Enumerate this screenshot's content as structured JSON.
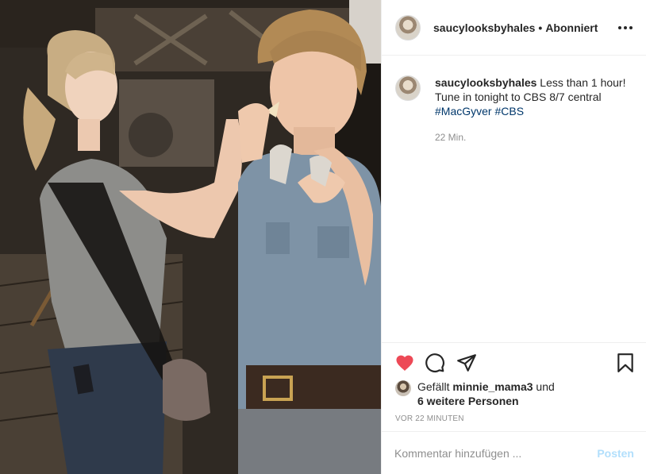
{
  "post": {
    "username": "saucylooksbyhales",
    "separator": "•",
    "follow_status": "Abonniert",
    "caption_user": "saucylooksbyhales",
    "caption_text": "Less than 1 hour! Tune in tonight to CBS 8/7 central",
    "hashtags": [
      "#MacGyver",
      "#CBS"
    ],
    "caption_time": "22 Min.",
    "liked": true,
    "likes_prefix": "Gefällt",
    "liked_by": "minnie_mama3",
    "likes_joiner": "und",
    "others": "6 weitere Personen",
    "posted_ago": "VOR 22 MINUTEN"
  },
  "composer": {
    "placeholder": "Kommentar hinzufügen ...",
    "post_label": "Posten"
  },
  "colors": {
    "like_red": "#ed4956",
    "hashtag_blue": "#00376b",
    "post_button_disabled": "#b2dffc",
    "meta_gray": "#8e8e8e"
  },
  "icons": {
    "like": "heart-icon",
    "comment": "comment-icon",
    "share": "paper-plane-icon",
    "save": "bookmark-icon",
    "more": "more-options-icon"
  }
}
